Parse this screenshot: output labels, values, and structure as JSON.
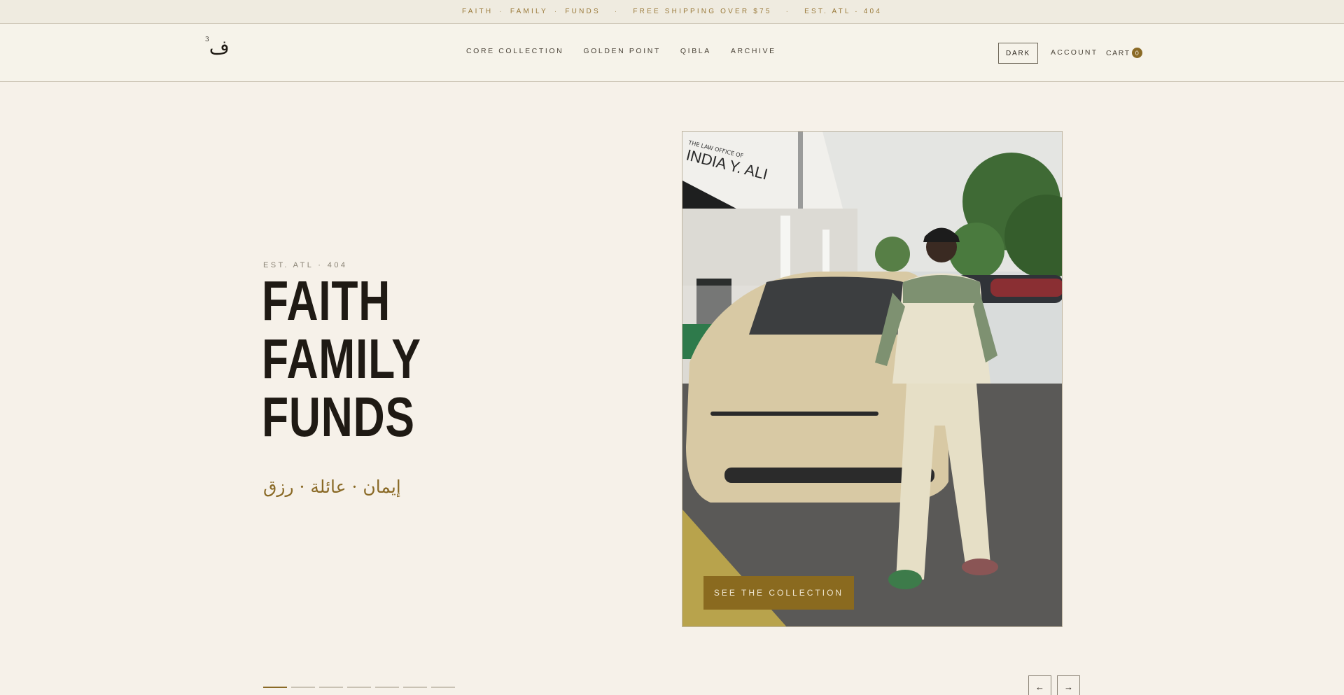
{
  "announcement": {
    "segments": [
      "FAITH",
      "FAMILY",
      "FUNDS"
    ],
    "shipping": "FREE SHIPPING OVER $75",
    "est": "EST. ATL · 404",
    "separator": "·"
  },
  "header": {
    "logo": "ف",
    "logo_sup": "3",
    "nav": [
      "CORE COLLECTION",
      "GOLDEN POINT",
      "QIBLA",
      "ARCHIVE"
    ],
    "dark_label": "DARK",
    "account_label": "ACCOUNT",
    "cart_label": "CART",
    "cart_count": "0"
  },
  "hero": {
    "eyebrow": "EST. ATL · 404",
    "headline": [
      "FAITH",
      "FAMILY",
      "FUNDS"
    ],
    "arabic": "إيمان · عائلة · رزق",
    "cta_label": "SEE THE COLLECTION",
    "photo_sign": "INDIA Y. ALI",
    "photo_sign_small": "THE LAW OFFICE OF",
    "slides_total": 7,
    "slide_active": 1,
    "prev_label": "←",
    "next_label": "→"
  },
  "colors": {
    "accent": "#8a6a26",
    "background": "#f6f1e9",
    "text": "#1f1a14"
  }
}
